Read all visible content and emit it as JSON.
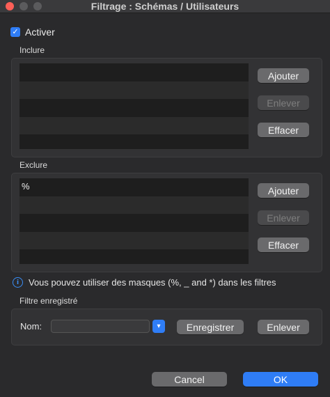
{
  "window": {
    "title": "Filtrage : Schémas / Utilisateurs"
  },
  "activate": {
    "label": "Activer",
    "checked": true
  },
  "include": {
    "label": "Inclure",
    "rows": [
      "",
      "",
      "",
      "",
      ""
    ],
    "buttons": {
      "add": "Ajouter",
      "remove": "Enlever",
      "clear": "Effacer"
    }
  },
  "exclude": {
    "label": "Exclure",
    "rows": [
      "%",
      "",
      "",
      "",
      ""
    ],
    "buttons": {
      "add": "Ajouter",
      "remove": "Enlever",
      "clear": "Effacer"
    }
  },
  "info": {
    "text": "Vous pouvez utiliser des masques (%, _ and *) dans les filtres"
  },
  "saved_filter": {
    "label": "Filtre enregistré",
    "name_label": "Nom:",
    "name_value": "",
    "save_button": "Enregistrer",
    "remove_button": "Enlever"
  },
  "footer": {
    "cancel": "Cancel",
    "ok": "OK"
  },
  "colors": {
    "accent": "#2f7df6",
    "close": "#ff5f57"
  }
}
